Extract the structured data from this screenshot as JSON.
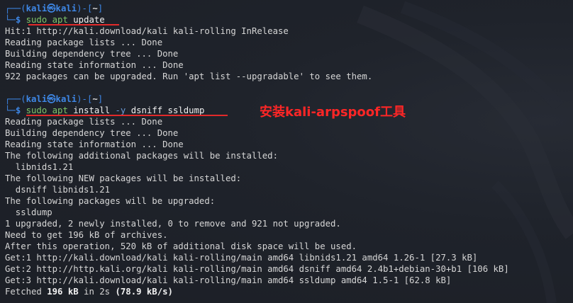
{
  "prompt": {
    "frame_top": "┌──(",
    "user_host": "kali㉿kali",
    "sep": ")-[",
    "dir": "~",
    "close": "]",
    "frame_bottom": "└─",
    "dollar": "$"
  },
  "commands": [
    {
      "sudo": "sudo",
      "apt": "apt",
      "args": "update"
    },
    {
      "sudo": "sudo",
      "apt": "apt",
      "args_pre": "install",
      "flag": "-y",
      "args_post": "dsniff ssldump"
    }
  ],
  "output_1": [
    "Hit:1 http://kali.download/kali kali-rolling InRelease",
    "Reading package lists ... Done",
    "Building dependency tree ... Done",
    "Reading state information ... Done",
    "922 packages can be upgraded. Run 'apt list --upgradable' to see them."
  ],
  "output_2": [
    "Reading package lists ... Done",
    "Building dependency tree ... Done",
    "Reading state information ... Done",
    "The following additional packages will be installed:",
    "  libnids1.21",
    "The following NEW packages will be installed:",
    "  dsniff libnids1.21",
    "The following packages will be upgraded:",
    "  ssldump",
    "1 upgraded, 2 newly installed, 0 to remove and 921 not upgraded.",
    "Need to get 196 kB of archives.",
    "After this operation, 520 kB of additional disk space will be used.",
    "Get:1 http://kali.download/kali kali-rolling/main amd64 libnids1.21 amd64 1.26-1 [27.3 kB]",
    "Get:2 http://http.kali.org/kali kali-rolling/main amd64 dsniff amd64 2.4b1+debian-30+b1 [106 kB]",
    "Get:3 http://kali.download/kali kali-rolling/main amd64 ssldump amd64 1.5-1 [62.8 kB]"
  ],
  "fetched": {
    "prefix": "Fetched ",
    "size": "196 kB",
    "mid": " in 2s ",
    "rate": "(78.9 kB/s)"
  },
  "annotation": "安装kali-arpspoof工具",
  "colors": {
    "accent_blue": "#3e87e6",
    "command_green": "#7fc66a",
    "annotation_red": "#ff2626",
    "background": "#1e222a"
  }
}
